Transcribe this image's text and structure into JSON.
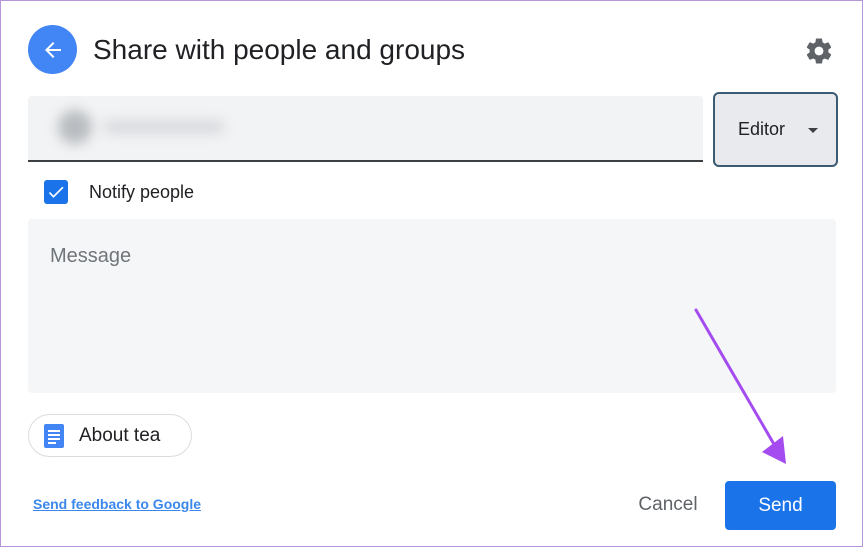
{
  "header": {
    "title": "Share with people and groups",
    "back_icon": "arrow-left-icon",
    "settings_icon": "gear-icon"
  },
  "recipient": {
    "value_blurred": true
  },
  "role": {
    "selected": "Editor"
  },
  "notify": {
    "label": "Notify people",
    "checked": true
  },
  "message": {
    "placeholder": "Message",
    "value": ""
  },
  "attachment": {
    "label": "About tea",
    "icon": "google-docs-icon"
  },
  "footer": {
    "feedback_link": "Send feedback to Google",
    "cancel_label": "Cancel",
    "send_label": "Send"
  },
  "colors": {
    "accent": "#1a73e8",
    "back_button": "#4285f4",
    "annotation_arrow": "#a44cf0"
  }
}
